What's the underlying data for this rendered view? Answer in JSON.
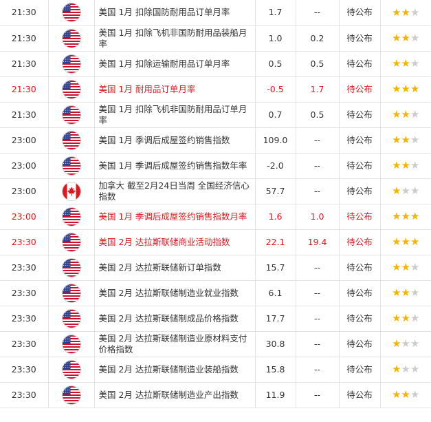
{
  "rows": [
    {
      "time": "21:30",
      "flag": "us-flag-icon",
      "event": "美国 1月 扣除国防耐用品订单月率",
      "previous": "1.7",
      "forecast": "--",
      "actual": "待公布",
      "importance": 2,
      "highlight": false
    },
    {
      "time": "21:30",
      "flag": "us-flag-icon",
      "event": "美国 1月 扣除飞机非国防耐用品装船月率",
      "previous": "1.0",
      "forecast": "0.2",
      "actual": "待公布",
      "importance": 2,
      "highlight": false
    },
    {
      "time": "21:30",
      "flag": "us-flag-icon",
      "event": "美国 1月 扣除运输耐用品订单月率",
      "previous": "0.5",
      "forecast": "0.5",
      "actual": "待公布",
      "importance": 2,
      "highlight": false
    },
    {
      "time": "21:30",
      "flag": "us-flag-icon",
      "event": "美国 1月 耐用品订单月率",
      "previous": "-0.5",
      "forecast": "1.7",
      "actual": "待公布",
      "importance": 3,
      "highlight": true
    },
    {
      "time": "21:30",
      "flag": "us-flag-icon",
      "event": "美国 1月 扣除飞机非国防耐用品订单月率",
      "previous": "0.7",
      "forecast": "0.5",
      "actual": "待公布",
      "importance": 2,
      "highlight": false
    },
    {
      "time": "23:00",
      "flag": "us-flag-icon",
      "event": "美国 1月 季调后成屋签约销售指数",
      "previous": "109.0",
      "forecast": "--",
      "actual": "待公布",
      "importance": 2,
      "highlight": false
    },
    {
      "time": "23:00",
      "flag": "us-flag-icon",
      "event": "美国 1月 季调后成屋签约销售指数年率",
      "previous": "-2.0",
      "forecast": "--",
      "actual": "待公布",
      "importance": 2,
      "highlight": false
    },
    {
      "time": "23:00",
      "flag": "ca-flag-icon",
      "event": "加拿大 截至2月24日当周 全国经济信心指数",
      "previous": "57.7",
      "forecast": "--",
      "actual": "待公布",
      "importance": 1,
      "highlight": false
    },
    {
      "time": "23:00",
      "flag": "us-flag-icon",
      "event": "美国 1月 季调后成屋签约销售指数月率",
      "previous": "1.6",
      "forecast": "1.0",
      "actual": "待公布",
      "importance": 3,
      "highlight": true
    },
    {
      "time": "23:30",
      "flag": "us-flag-icon",
      "event": "美国 2月 达拉斯联储商业活动指数",
      "previous": "22.1",
      "forecast": "19.4",
      "actual": "待公布",
      "importance": 3,
      "highlight": true
    },
    {
      "time": "23:30",
      "flag": "us-flag-icon",
      "event": "美国 2月 达拉斯联储新订单指数",
      "previous": "15.7",
      "forecast": "--",
      "actual": "待公布",
      "importance": 2,
      "highlight": false
    },
    {
      "time": "23:30",
      "flag": "us-flag-icon",
      "event": "美国 2月 达拉斯联储制造业就业指数",
      "previous": "6.1",
      "forecast": "--",
      "actual": "待公布",
      "importance": 2,
      "highlight": false
    },
    {
      "time": "23:30",
      "flag": "us-flag-icon",
      "event": "美国 2月 达拉斯联储制成品价格指数",
      "previous": "17.7",
      "forecast": "--",
      "actual": "待公布",
      "importance": 2,
      "highlight": false
    },
    {
      "time": "23:30",
      "flag": "us-flag-icon",
      "event": "美国 2月 达拉斯联储制造业原材料支付价格指数",
      "previous": "30.8",
      "forecast": "--",
      "actual": "待公布",
      "importance": 1,
      "highlight": false
    },
    {
      "time": "23:30",
      "flag": "us-flag-icon",
      "event": "美国 2月 达拉斯联储制造业装船指数",
      "previous": "15.8",
      "forecast": "--",
      "actual": "待公布",
      "importance": 1,
      "highlight": false
    },
    {
      "time": "23:30",
      "flag": "us-flag-icon",
      "event": "美国 2月 达拉斯联储制造业产出指数",
      "previous": "11.9",
      "forecast": "--",
      "actual": "待公布",
      "importance": 2,
      "highlight": false
    }
  ],
  "max_stars": 3,
  "colors": {
    "highlight": "#e0171e",
    "star_on": "#f4b400",
    "star_off": "#cccccc"
  }
}
